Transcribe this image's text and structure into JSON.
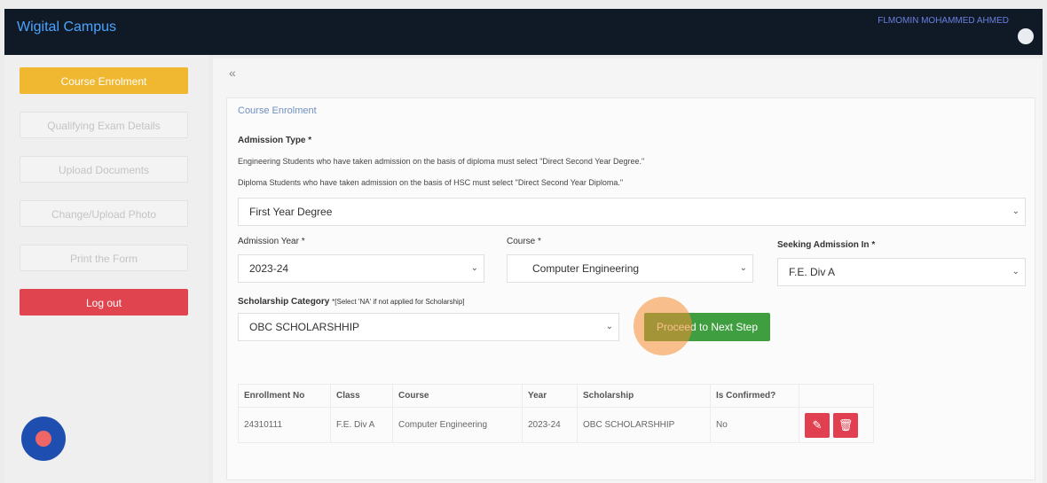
{
  "header": {
    "brand": "Wigital Campus",
    "user_name": "FLMOMIN MOHAMMED AHMED",
    "avatar_icon": "user-avatar-icon"
  },
  "sidebar": {
    "items": [
      {
        "label": "Course Enrolment",
        "state": "active"
      },
      {
        "label": "Qualifying Exam Details",
        "state": "disabled"
      },
      {
        "label": "Upload Documents",
        "state": "disabled"
      },
      {
        "label": "Change/Upload Photo",
        "state": "disabled"
      },
      {
        "label": "Print the Form",
        "state": "disabled"
      }
    ],
    "logout_label": "Log out"
  },
  "main": {
    "collapse_icon": "«",
    "panel_title": "Course Enrolment",
    "admission_type": {
      "label": "Admission Type *",
      "hint1": "Engineering Students who have taken admission on the basis of diploma must select \"Direct Second Year Degree.\"",
      "hint2": "Diploma Students who have taken admission on the basis of HSC must select \"Direct Second Year Diploma.\"",
      "value": "First Year Degree"
    },
    "admission_year": {
      "label": "Admission Year *",
      "value": "2023-24"
    },
    "course": {
      "label": "Course *",
      "value": "Computer Engineering"
    },
    "seeking_admission": {
      "label": "Seeking Admission In *",
      "value": "F.E. Div A"
    },
    "scholarship": {
      "label": "Scholarship Category",
      "note": "*[Select 'NA' if not applied for Scholarship]",
      "value": "OBC SCHOLARSHHIP"
    },
    "proceed_label": "Proceed to Next Step",
    "table": {
      "headers": [
        "Enrollment No",
        "Class",
        "Course",
        "Year",
        "Scholarship",
        "Is Confirmed?",
        ""
      ],
      "rows": [
        [
          "24310111",
          "F.E. Div A",
          "Computer Engineering",
          "2023-24",
          "OBC SCHOLARSHHIP",
          "No"
        ]
      ],
      "edit_icon": "edit-icon",
      "delete_icon": "trash-icon"
    }
  },
  "colors": {
    "topbar": "#0f1a26",
    "active_tab": "#f0b730",
    "logout": "#e0454f",
    "proceed": "#3f9e3f",
    "danger": "#e04050",
    "touch_indicator": "#f58c32"
  }
}
